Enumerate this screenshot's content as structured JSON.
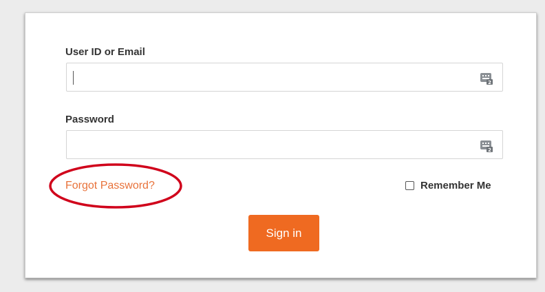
{
  "form": {
    "user_label": "User ID or Email",
    "user_value": "",
    "password_label": "Password",
    "password_value": "",
    "forgot_link": "Forgot Password?",
    "remember_label": "Remember Me",
    "remember_checked": false,
    "signin_label": "Sign in"
  },
  "icons": {
    "field_icon": "keyboard-icon",
    "checkbox": "checkbox-icon"
  },
  "colors": {
    "accent": "#ef6a21",
    "link": "#e8723a",
    "annotation": "#d0021b",
    "background": "#ececec",
    "card": "#ffffff"
  }
}
